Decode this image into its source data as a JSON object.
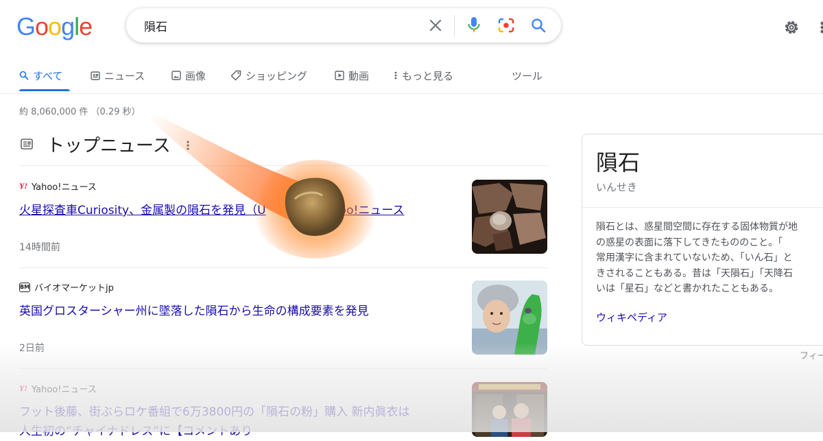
{
  "logo": {
    "letters": [
      "G",
      "o",
      "o",
      "g",
      "l",
      "e"
    ],
    "colors": [
      "#4285f4",
      "#ea4335",
      "#fbbc05",
      "#4285f4",
      "#34a853",
      "#ea4335"
    ]
  },
  "search": {
    "query": "隕石"
  },
  "tabs": [
    {
      "label": "すべて",
      "icon": "search-icon"
    },
    {
      "label": "ニュース",
      "icon": "news-icon"
    },
    {
      "label": "画像",
      "icon": "image-icon"
    },
    {
      "label": "ショッピング",
      "icon": "tag-icon"
    },
    {
      "label": "動画",
      "icon": "video-icon"
    },
    {
      "label": "もっと見る",
      "icon": "more-vert-icon"
    }
  ],
  "tools_label": "ツール",
  "result_stats": "約 8,060,000 件 （0.29 秒）",
  "top_news": {
    "title": "トップニュース",
    "items": [
      {
        "source": "Yahoo!ニュース",
        "source_logo": "Y!",
        "headline": "火星探査車Curiosity、金属製の隕石を発見（U",
        "headline_tail": "Yahoo!ニュース",
        "time": "14時間前"
      },
      {
        "source": "バイオマーケットjp",
        "source_logo": "BM",
        "headline": "英国グロスターシャー州に墜落した隕石から生命の構成要素を発見",
        "time": "2日前"
      },
      {
        "source": "Yahoo!ニュース",
        "source_logo": "Y!",
        "headline": "フット後藤、街ぶらロケ番組で6万3800円の「隕石の粉」購入 新内眞衣は",
        "headline2": "人生初の“チャイナドレス”に【コメントあり"
      }
    ]
  },
  "knowledge_panel": {
    "title": "隕石",
    "reading": "いんせき",
    "description_lines": [
      "隕石とは、惑星間空間に存在する固体物質が地",
      "の惑星の表面に落下してきたもののこと。「",
      "常用漢字に含まれていないため、「いん石」と",
      "きされることもある。昔は「天隕石」「天降石",
      "いは「星石」などと書かれたこともある。"
    ],
    "source_link": "ウィキペディア"
  },
  "feedback_label": "フィー",
  "colors": {
    "link": "#1a0dab",
    "accent": "#1a73e8",
    "yahoo": "#ff0033"
  }
}
